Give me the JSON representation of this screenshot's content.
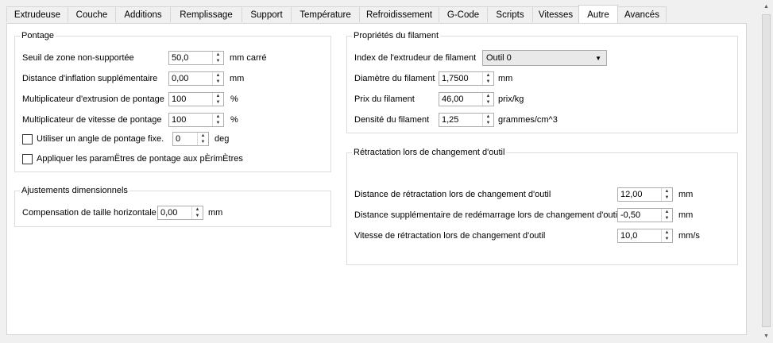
{
  "tabs": [
    {
      "label": "Extrudeuse",
      "active": false
    },
    {
      "label": "Couche",
      "active": false
    },
    {
      "label": "Additions",
      "active": false
    },
    {
      "label": "Remplissage",
      "active": false
    },
    {
      "label": "Support",
      "active": false
    },
    {
      "label": "Température",
      "active": false
    },
    {
      "label": "Refroidissement",
      "active": false
    },
    {
      "label": "G-Code",
      "active": false
    },
    {
      "label": "Scripts",
      "active": false
    },
    {
      "label": "Vitesses",
      "active": false
    },
    {
      "label": "Autre",
      "active": true
    },
    {
      "label": "Avancés",
      "active": false
    }
  ],
  "bridging": {
    "title": "Pontage",
    "unsupported_threshold": {
      "label": "Seuil de zone non-supportée",
      "value": "50,0",
      "unit": "mm carré"
    },
    "extra_inflation": {
      "label": "Distance d'inflation supplémentaire",
      "value": "0,00",
      "unit": "mm"
    },
    "extrusion_multiplier": {
      "label": "Multiplicateur d'extrusion de pontage",
      "value": "100",
      "unit": "%"
    },
    "speed_multiplier": {
      "label": "Multiplicateur de vitesse de pontage",
      "value": "100",
      "unit": "%"
    },
    "fixed_angle": {
      "label": "Utiliser un angle de pontage fixe.",
      "value": "0",
      "unit": "deg",
      "checked": false
    },
    "apply_perimeters": {
      "label": "Appliquer les paramËtres de pontage aux pÈrimÈtres",
      "checked": false
    }
  },
  "dimensional": {
    "title": "Ajustements dimensionnels",
    "horizontal_compensation": {
      "label": "Compensation de taille horizontale",
      "value": "0,00",
      "unit": "mm"
    }
  },
  "filament": {
    "title": "Propriétés du filament",
    "extruder_index": {
      "label": "Index de l'extrudeur de filament",
      "value": "Outil 0"
    },
    "diameter": {
      "label": "Diamètre du filament",
      "value": "1,7500",
      "unit": "mm"
    },
    "price": {
      "label": "Prix du filament",
      "value": "46,00",
      "unit": "prix/kg"
    },
    "density": {
      "label": "Densité du filament",
      "value": "1,25",
      "unit": "grammes/cm^3"
    }
  },
  "toolchange": {
    "title": "Rétractation lors de changement d'outil",
    "retract_distance": {
      "label": "Distance de rétractation lors de changement d'outil",
      "value": "12,00",
      "unit": "mm"
    },
    "extra_restart": {
      "label": "Distance supplémentaire de redémarrage lors de changement d'outil",
      "value": "-0,50",
      "unit": "mm"
    },
    "retract_speed": {
      "label": "Vitesse de rétractation lors de changement d'outil",
      "value": "10,0",
      "unit": "mm/s"
    }
  },
  "icons": {
    "spin_up": "spin-up-arrow-icon",
    "spin_down": "spin-down-arrow-icon",
    "dropdown": "chevron-down-icon"
  }
}
